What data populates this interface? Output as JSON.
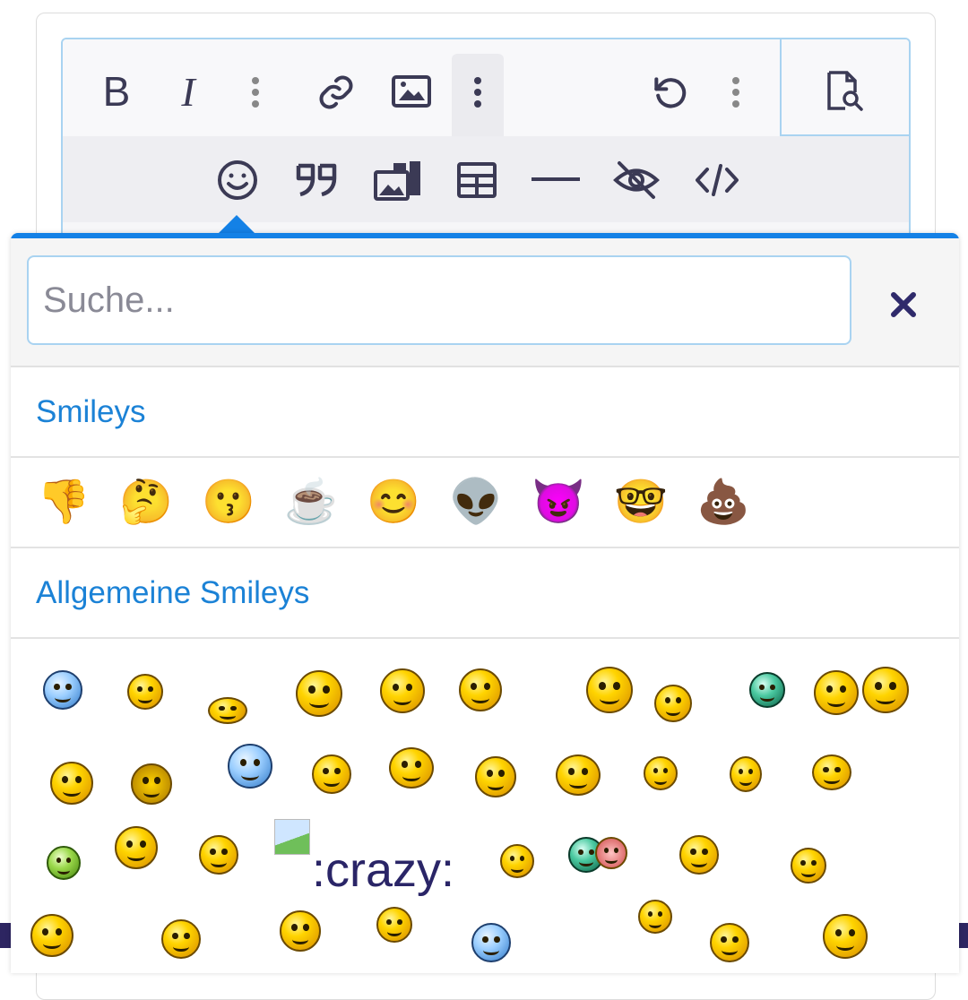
{
  "toolbar": {
    "bold_label": "B",
    "italic_label": "I",
    "row1_icons": [
      "bold-icon",
      "italic-icon",
      "more-vertical-icon",
      "link-icon",
      "image-icon",
      "more-vertical-icon",
      "undo-icon",
      "more-vertical-icon",
      "preview-icon"
    ],
    "row2_icons": [
      "smiley-icon",
      "quote-icon",
      "gallery-icon",
      "table-icon",
      "horizontal-rule-icon",
      "spoiler-hidden-icon",
      "code-icon"
    ]
  },
  "emoji_picker": {
    "search": {
      "placeholder": "Suche...",
      "value": ""
    },
    "close_icon": "close-icon",
    "categories": [
      {
        "title": "Smileys",
        "items": [
          "👎",
          "🤔",
          "😗",
          "☕",
          "😊",
          "👽",
          "😈",
          "🤓",
          "💩"
        ]
      },
      {
        "title": "Allgemeine Smileys",
        "broken_item_text": ":crazy:"
      }
    ]
  },
  "colors": {
    "accent": "#1481e6",
    "category_title": "#1b82d6",
    "icon": "#3b3a55",
    "editor_border": "#a9d3f1",
    "bottom_bar": "#2d2561"
  }
}
